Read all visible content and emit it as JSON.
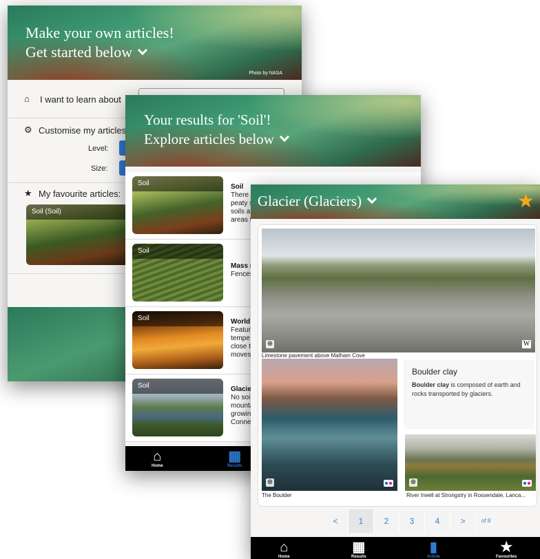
{
  "screen_home": {
    "title_line1": "Make your own articles!",
    "title_line2": "Get started below",
    "photo_credit": "Photo by NASA",
    "learn_label": "I want to learn about",
    "customise_label": "Customise my articles",
    "level_label": "Level:",
    "size_label": "Size:",
    "favourites_label": "My favourite articles:",
    "favourite_card": "Soil (Soil)"
  },
  "screen_results": {
    "title_line1": "Your results for 'Soil'!",
    "title_line2": "Explore articles below",
    "results": [
      {
        "tag": "Soil",
        "title": "Soil",
        "text": "There peaty s soils a areas t"
      },
      {
        "tag": "Soil",
        "title": "Mass m",
        "text": "Fences"
      },
      {
        "tag": "Soil",
        "title": "World",
        "text": "Featur tempe close t moves"
      },
      {
        "tag": "Soil",
        "title": "Glacie",
        "text": "No soi mounta growin Conne"
      }
    ],
    "tabs": {
      "home": "Home",
      "results": "Results"
    }
  },
  "screen_article": {
    "title": "Glacier (Glaciers)",
    "images": {
      "limestone_caption": "Limestone pavement above Malham Cove",
      "boulder_caption": "The Boulder",
      "river_caption": "River Irwell at Strongstry in Rossendale, Lanca..."
    },
    "boulder_clay": {
      "heading": "Boulder clay",
      "bold": "Boulder clay",
      "text": " is composed of earth and rocks transported by glaciers."
    },
    "pagination": {
      "prev": "<",
      "pages": [
        "1",
        "2",
        "3",
        "4"
      ],
      "next": ">",
      "total": "of 8",
      "current": 1
    },
    "tabs": {
      "home": "Home",
      "results": "Results",
      "article": "Article",
      "favourites": "Favourites"
    }
  },
  "colors": {
    "accent": "#3a82c4",
    "star": "#f2a91c",
    "tab_active": "#2d7bd2"
  }
}
